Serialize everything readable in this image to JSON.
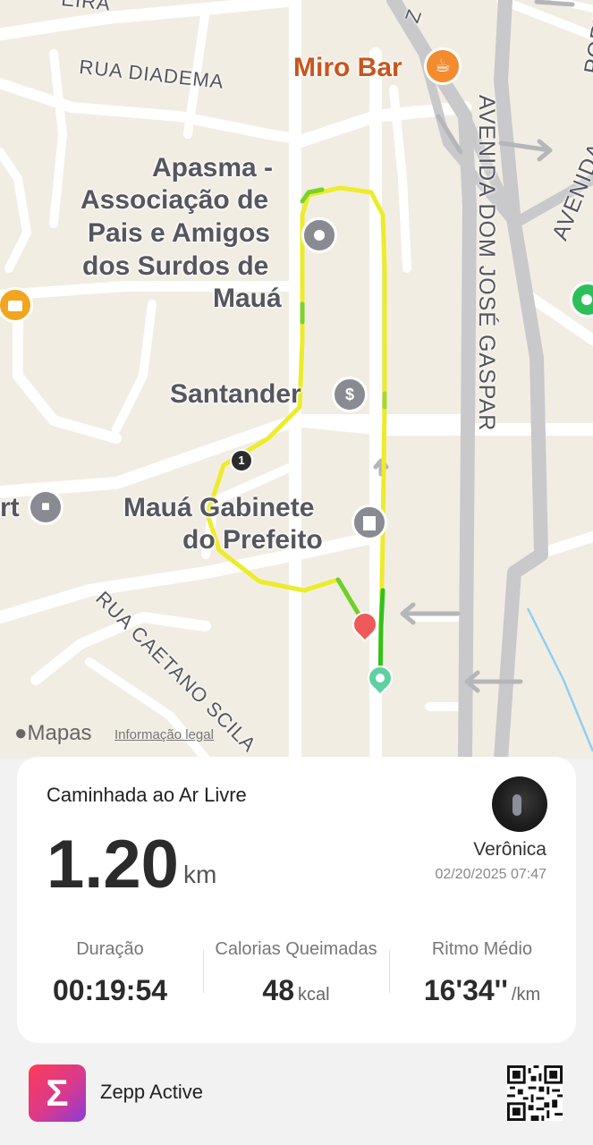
{
  "map": {
    "pois": {
      "miro_bar": "Miro Bar",
      "apasma": [
        "Apasma -",
        "Associação de",
        "Pais e Amigos",
        "dos Surdos de",
        "Mauá"
      ],
      "santander": "Santander",
      "gabinete": [
        "Mauá Gabinete",
        "do Prefeito"
      ],
      "left_partial": "rt"
    },
    "streets": {
      "diadema": "RUA DIADEMA",
      "caetano": "RUA CAETANO SCILA",
      "dom_jose": "AVENIDA DOM JOSÉ GASPAR",
      "avenida_top": "AVENIDA",
      "porti": "PORTI",
      "top_left": "EIRA",
      "top_z": "Z"
    },
    "km_marker": "1",
    "brand": "Mapas",
    "legal": "Informação legal"
  },
  "summary": {
    "activity": "Caminhada ao Ar Livre",
    "distance": "1.20",
    "distance_unit": "km",
    "user_name": "Verônica",
    "date": "02/20/2025 07:47"
  },
  "stats": [
    {
      "label": "Duração",
      "value": "00:19:54",
      "unit": ""
    },
    {
      "label": "Calorias Queimadas",
      "value": "48",
      "unit": "kcal"
    },
    {
      "label": "Ritmo Médio",
      "value": "16'34''",
      "unit": "/km"
    }
  ],
  "footer": {
    "app_name": "Zepp Active",
    "logo_glyph": "Σ"
  },
  "colors": {
    "route": "#ecec2a",
    "route_green": "#33c21a",
    "start_pin": "#5fd0a0",
    "end_pin": "#ee5a5a",
    "poi_orange": "#f28c2e"
  }
}
